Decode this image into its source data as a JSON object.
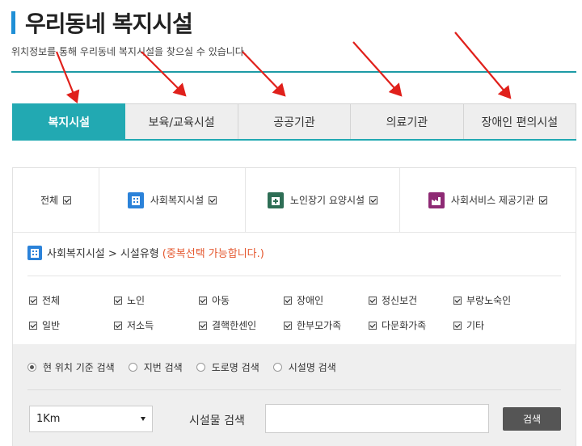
{
  "page": {
    "title": "우리동네 복지시설",
    "subtitle": "위치정보를 통해 우리동네 복지시설을 찾으실 수 있습니다."
  },
  "tabs": [
    {
      "label": "복지시설",
      "active": true
    },
    {
      "label": "보육/교육시설",
      "active": false
    },
    {
      "label": "공공기관",
      "active": false
    },
    {
      "label": "의료기관",
      "active": false
    },
    {
      "label": "장애인 편의시설",
      "active": false
    }
  ],
  "categories": {
    "all_label": "전체",
    "items": [
      {
        "label": "사회복지시설",
        "icon": "building-icon",
        "color": "#2b82d9"
      },
      {
        "label": "노인장기 요양시설",
        "icon": "nursing-facility-icon",
        "color": "#2e6e55"
      },
      {
        "label": "사회서비스 제공기관",
        "icon": "factory-icon",
        "color": "#8e2a74"
      }
    ]
  },
  "facility_type": {
    "breadcrumb": "사회복지시설 > 시설유형",
    "hint": "(중복선택 가능합니다.)",
    "items": [
      "전체",
      "노인",
      "아동",
      "장애인",
      "정신보건",
      "부랑노숙인",
      "일반",
      "저소득",
      "결핵한센인",
      "한부모가족",
      "다문화가족",
      "기타"
    ]
  },
  "search": {
    "modes": [
      {
        "label": "현 위치 기준 검색",
        "selected": true
      },
      {
        "label": "지번 검색",
        "selected": false
      },
      {
        "label": "도로명 검색",
        "selected": false
      },
      {
        "label": "시설명 검색",
        "selected": false
      }
    ],
    "distance": "1Km",
    "name_label": "시설물 검색",
    "name_value": "",
    "button": "검색"
  },
  "colors": {
    "accent": "#22a9b2",
    "title_bar": "#1f8fd6",
    "annotation_arrow": "#e0201b"
  }
}
